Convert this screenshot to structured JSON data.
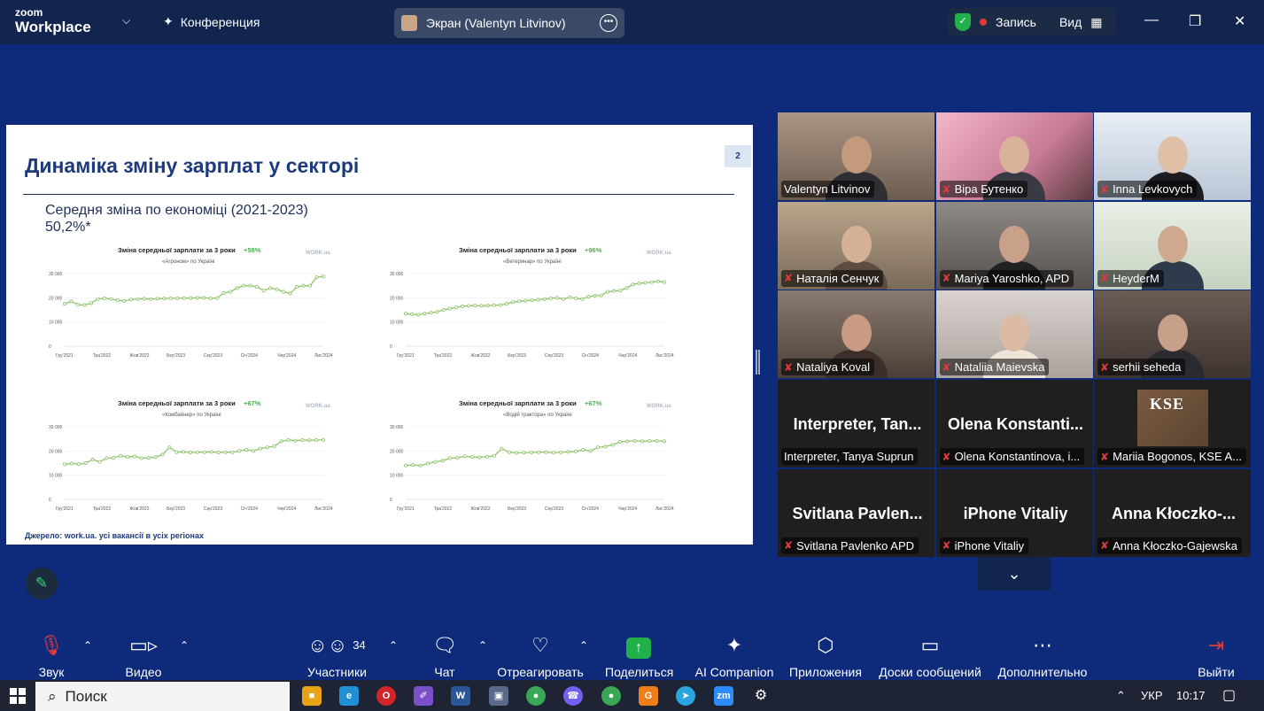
{
  "app": {
    "brand_top": "zoom",
    "brand_bottom": "Workplace",
    "conference": "Конференция",
    "screen_share": "Экран (Valentyn Litvinov)",
    "record": "Запись",
    "view": "Вид"
  },
  "slide": {
    "title": "Динаміка зміну зарплат у секторі",
    "page": "2",
    "subtitle_line1": "Середня зміна по економіці (2021-2023)",
    "subtitle_line2": "50,2%*",
    "source": "Джерело: work.ua. усі вакансії в усіх регіонах"
  },
  "chart_data": [
    {
      "type": "line",
      "title": "Зміна середньої зарплати за 3 роки",
      "change": "+58%",
      "subtitle": "«Агроном» по Україні",
      "brand": "WORK.ua",
      "yticks": [
        "0",
        "10 000",
        "20 000",
        "30 000"
      ],
      "ylim": [
        0,
        30000
      ],
      "xticks": [
        "Гру'2021",
        "Тра'2022",
        "Жов'2022",
        "Бер'2023",
        "Сер'2023",
        "Січ'2024",
        "Чер'2024",
        "Лис'2024"
      ],
      "values": [
        17500,
        18500,
        17200,
        17000,
        17800,
        19500,
        19800,
        19500,
        19000,
        18700,
        19300,
        19500,
        19600,
        19500,
        19600,
        19700,
        19800,
        19800,
        19900,
        19900,
        20000,
        20000,
        19800,
        19900,
        22000,
        22500,
        24000,
        25000,
        25000,
        24500,
        23000,
        24000,
        23500,
        22500,
        21800,
        24500,
        25000,
        25000,
        28500,
        28800
      ]
    },
    {
      "type": "line",
      "title": "Зміна середньої зарплати за 3 роки",
      "change": "+96%",
      "subtitle": "«Ветеринар» по Україні",
      "brand": "WORK.ua",
      "yticks": [
        "0",
        "10 000",
        "20 000",
        "30 000"
      ],
      "ylim": [
        0,
        30000
      ],
      "xticks": [
        "Гру'2021",
        "Тра'2022",
        "Жов'2022",
        "Бер'2023",
        "Сер'2023",
        "Січ'2024",
        "Чер'2024",
        "Лис'2024"
      ],
      "values": [
        13500,
        13200,
        13000,
        13500,
        13800,
        14200,
        15000,
        15500,
        16000,
        16500,
        16700,
        16800,
        16700,
        16800,
        16900,
        17000,
        17500,
        18200,
        18500,
        18800,
        19000,
        19200,
        19500,
        19800,
        20000,
        19500,
        20200,
        19800,
        19500,
        20500,
        20800,
        21000,
        22500,
        22800,
        23000,
        24000,
        25500,
        26000,
        26200,
        26500,
        26800,
        26500
      ]
    },
    {
      "type": "line",
      "title": "Зміна середньої зарплати за 3 роки",
      "change": "+67%",
      "subtitle": "«Комбайнер» по Україні",
      "brand": "WORK.ua",
      "yticks": [
        "0",
        "10 000",
        "20 000",
        "30 000"
      ],
      "ylim": [
        0,
        30000
      ],
      "xticks": [
        "Гру'2021",
        "Тра'2022",
        "Жов'2022",
        "Бер'2023",
        "Сер'2023",
        "Січ'2024",
        "Чер'2024",
        "Лис'2024"
      ],
      "values": [
        14500,
        14800,
        14600,
        15000,
        16500,
        15500,
        17000,
        17200,
        18000,
        17500,
        17800,
        17000,
        17200,
        17500,
        18500,
        21500,
        19500,
        19600,
        19400,
        19500,
        19500,
        19600,
        19400,
        19500,
        19500,
        20000,
        20500,
        20000,
        21000,
        21500,
        22000,
        24000,
        24500,
        24300,
        24500,
        24400,
        24500,
        24600
      ]
    },
    {
      "type": "line",
      "title": "Зміна середньої зарплати за 3 роки",
      "change": "+67%",
      "subtitle": "«Водій тракторa» по Україні",
      "brand": "WORK.ua",
      "yticks": [
        "0",
        "10 000",
        "20 000",
        "30 000"
      ],
      "ylim": [
        0,
        30000
      ],
      "xticks": [
        "Гру'2021",
        "Тра'2022",
        "Жов'2022",
        "Бер'2023",
        "Сер'2023",
        "Січ'2024",
        "Чер'2024",
        "Лис'2024"
      ],
      "values": [
        14000,
        14200,
        14000,
        14800,
        15500,
        16000,
        17000,
        17200,
        17800,
        17500,
        17400,
        17600,
        18000,
        21000,
        19500,
        19200,
        19300,
        19400,
        19500,
        19500,
        19300,
        19500,
        19600,
        19800,
        20500,
        20000,
        21500,
        21800,
        22500,
        23800,
        24000,
        24200,
        24000,
        24100,
        24200,
        24000
      ]
    }
  ],
  "participants": [
    {
      "name": "Valentyn Litvinov",
      "muted": false
    },
    {
      "name": "Віра Бутенко",
      "muted": true
    },
    {
      "name": "Inna Levkovych",
      "muted": true
    },
    {
      "name": "Наталія Сенчук",
      "muted": true
    },
    {
      "name": "Mariya Yaroshko, APD",
      "muted": true
    },
    {
      "name": "HeyderM",
      "muted": true
    },
    {
      "name": "Nataliya Koval",
      "muted": true
    },
    {
      "name": "Nataliia Maievska",
      "muted": true
    },
    {
      "name": "serhii seheda",
      "muted": true
    },
    {
      "name": "Interpreter, Tanya Suprun",
      "big": "Interpreter,  Tan...",
      "muted": false
    },
    {
      "name": "Olena Konstantinova, i...",
      "big": "Olena  Konstanti...",
      "muted": true
    },
    {
      "name": "Mariia Bogonos, KSE A...",
      "muted": true
    },
    {
      "name": "Svitlana Pavlenko APD",
      "big": "Svitlana  Pavlen...",
      "muted": true
    },
    {
      "name": "iPhone Vitaliy",
      "big": "iPhone Vitaliy",
      "muted": true
    },
    {
      "name": "Anna Kłoczko-Gajewska",
      "big": "Anna  Kłoczko-...",
      "muted": true
    }
  ],
  "kse_logo": "KSE",
  "toolbar": {
    "audio": "Звук",
    "video": "Видео",
    "participants": "Участники",
    "participants_count": "34",
    "chat": "Чат",
    "react": "Отреагировать",
    "share": "Поделиться",
    "ai": "AI Companion",
    "apps": "Приложения",
    "boards": "Доски сообщений",
    "more": "Дополнительно",
    "exit": "Выйти"
  },
  "taskbar": {
    "search": "Поиск",
    "lang": "УКР",
    "time": "10:17"
  },
  "colors": {
    "accent_green": "#22b04b",
    "mute_red": "#e23b3b",
    "chart_line": "#8fc46a"
  }
}
